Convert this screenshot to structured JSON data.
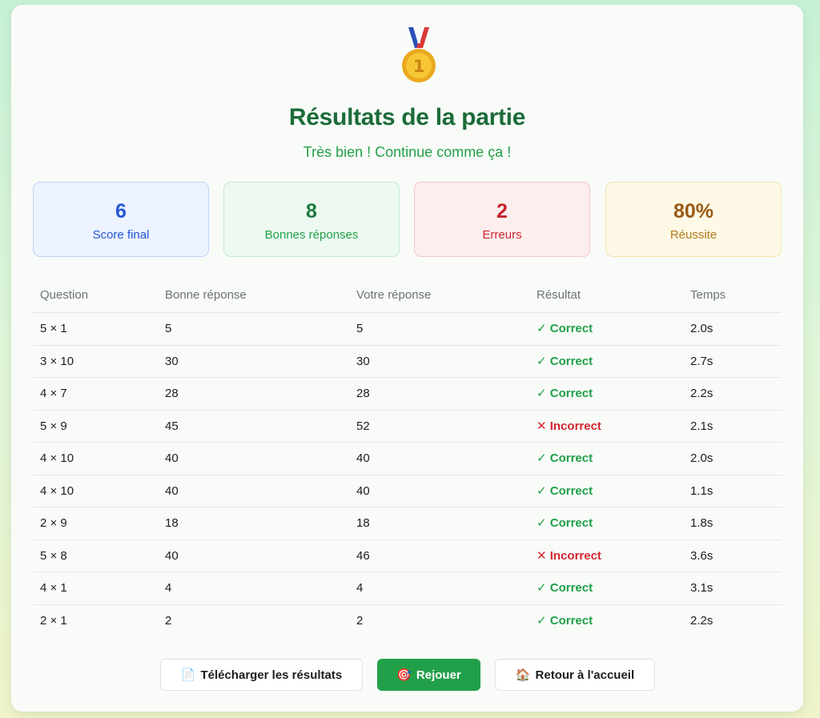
{
  "header": {
    "medal_icon": "gold-medal-1-icon",
    "title": "Résultats de la partie",
    "subtitle": "Très bien ! Continue comme ça !"
  },
  "stats": [
    {
      "value": "6",
      "label": "Score final",
      "color": "#2457d6"
    },
    {
      "value": "8",
      "label": "Bonnes réponses",
      "color": "#1c7a3e"
    },
    {
      "value": "2",
      "label": "Erreurs",
      "color": "#c4222a"
    },
    {
      "value": "80%",
      "label": "Réussite",
      "color": "#9a5a14"
    }
  ],
  "table": {
    "headers": [
      "Question",
      "Bonne réponse",
      "Votre réponse",
      "Résultat",
      "Temps"
    ],
    "rows": [
      {
        "question": "5 × 1",
        "correct": "5",
        "answer": "5",
        "result": "✓ Correct",
        "ok": true,
        "time": "2.0s"
      },
      {
        "question": "3 × 10",
        "correct": "30",
        "answer": "30",
        "result": "✓ Correct",
        "ok": true,
        "time": "2.7s"
      },
      {
        "question": "4 × 7",
        "correct": "28",
        "answer": "28",
        "result": "✓ Correct",
        "ok": true,
        "time": "2.2s"
      },
      {
        "question": "5 × 9",
        "correct": "45",
        "answer": "52",
        "result": "✕ Incorrect",
        "ok": false,
        "time": "2.1s"
      },
      {
        "question": "4 × 10",
        "correct": "40",
        "answer": "40",
        "result": "✓ Correct",
        "ok": true,
        "time": "2.0s"
      },
      {
        "question": "4 × 10",
        "correct": "40",
        "answer": "40",
        "result": "✓ Correct",
        "ok": true,
        "time": "1.1s"
      },
      {
        "question": "2 × 9",
        "correct": "18",
        "answer": "18",
        "result": "✓ Correct",
        "ok": true,
        "time": "1.8s"
      },
      {
        "question": "5 × 8",
        "correct": "40",
        "answer": "46",
        "result": "✕ Incorrect",
        "ok": false,
        "time": "3.6s"
      },
      {
        "question": "4 × 1",
        "correct": "4",
        "answer": "4",
        "result": "✓ Correct",
        "ok": true,
        "time": "3.1s"
      },
      {
        "question": "2 × 1",
        "correct": "2",
        "answer": "2",
        "result": "✓ Correct",
        "ok": true,
        "time": "2.2s"
      }
    ]
  },
  "actions": {
    "download": {
      "icon": "📄",
      "label": "Télécharger les résultats"
    },
    "replay": {
      "icon": "🎯",
      "label": "Rejouer"
    },
    "home": {
      "icon": "🏠",
      "label": "Retour à l'accueil"
    }
  },
  "colors": {
    "accent": "#22a049",
    "title": "#1c6b3a",
    "correct": "#1f9e48",
    "incorrect": "#d3262f"
  }
}
